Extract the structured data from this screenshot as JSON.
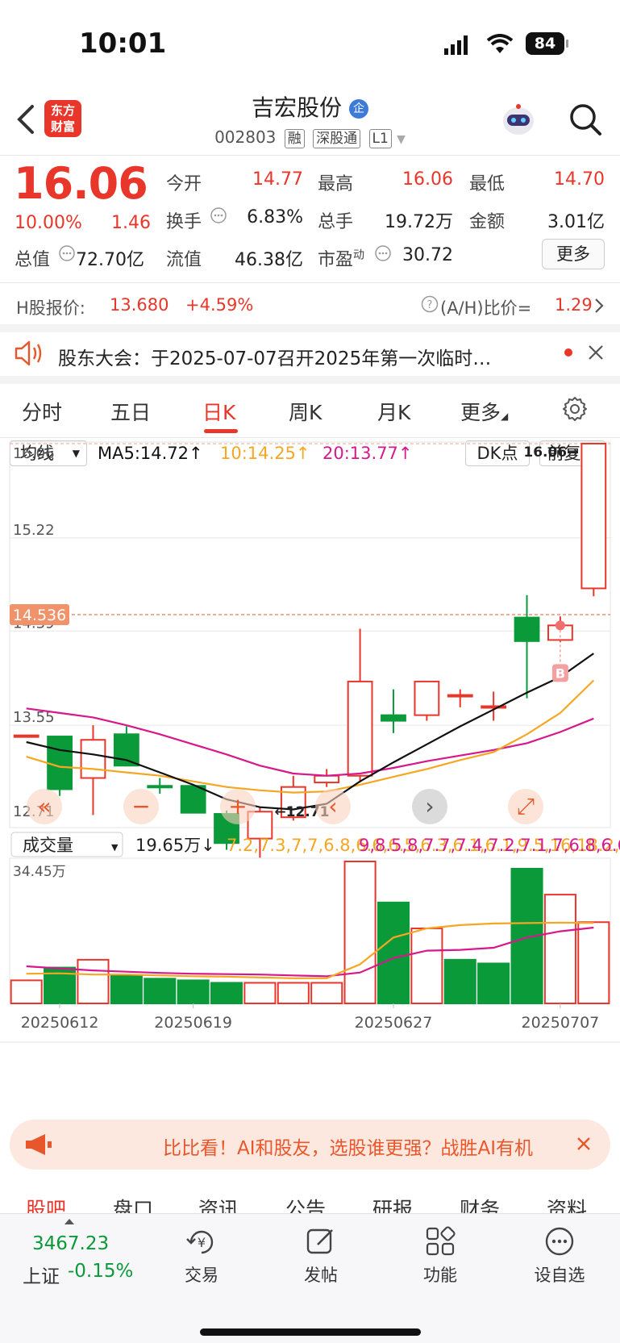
{
  "status_bar": {
    "time": "10:01",
    "battery": "84"
  },
  "header": {
    "logo_text": "东方\n财富",
    "title": "吉宏股份",
    "badge": "企",
    "code": "002803",
    "tags": [
      "融",
      "深股通",
      "L1"
    ]
  },
  "quote": {
    "price": "16.06",
    "change_pct": "10.00%",
    "change_abs": "1.46",
    "rows": [
      [
        {
          "label": "今开",
          "value": "14.77",
          "color": "red"
        },
        {
          "label": "最高",
          "value": "16.06",
          "color": "red"
        },
        {
          "label": "最低",
          "value": "14.70",
          "color": "red"
        }
      ],
      [
        {
          "label": "换手",
          "value": "6.83%",
          "color": "dark"
        },
        {
          "label": "总手",
          "value": "19.72万",
          "color": "dark"
        },
        {
          "label": "金额",
          "value": "3.01亿",
          "color": "dark"
        }
      ]
    ],
    "total_value_label": "总值",
    "total_value": "72.70亿",
    "float_value_label": "流值",
    "float_value": "46.38亿",
    "pe_label": "市盈",
    "pe_sup": "动",
    "pe_value": "30.72",
    "more_label": "更多"
  },
  "h_share": {
    "label": "H股报价:",
    "price": "13.680",
    "change": "+4.59%",
    "ratio_label": "(A/H)比价=",
    "ratio": "1.29"
  },
  "notice": {
    "text": "股东大会：于2025-07-07召开2025年第一次临时…"
  },
  "tabs": [
    {
      "label": "分时",
      "active": false
    },
    {
      "label": "五日",
      "active": false
    },
    {
      "label": "日K",
      "active": true
    },
    {
      "label": "周K",
      "active": false
    },
    {
      "label": "月K",
      "active": false
    },
    {
      "label": "更多",
      "active": false
    }
  ],
  "ma_bar": {
    "selector": "均线",
    "ma5": "MA5:14.72↑",
    "ma10": "10:14.25↑",
    "ma20": "20:13.77↑",
    "dk": "DK点",
    "adjust": "前复权"
  },
  "colors": {
    "up": "#e8362b",
    "down": "#0a9a3a",
    "ma5": "#111111",
    "ma10": "#f5a623",
    "ma20": "#d6188c"
  },
  "chart_data": {
    "type": "candlestick",
    "price_axis_labels": [
      "16.06",
      "15.22",
      "14.39",
      "13.55",
      "12.71"
    ],
    "ylim": [
      12.71,
      16.06
    ],
    "current_price_marker": "14.536",
    "high_annotation": "16.06→",
    "low_annotation": "←12.71",
    "buy_marker": "B",
    "candles": [
      {
        "o": 13.46,
        "h": 13.46,
        "l": 13.46,
        "c": 13.46
      },
      {
        "o": 13.45,
        "h": 13.45,
        "l": 12.92,
        "c": 12.98
      },
      {
        "o": 13.08,
        "h": 13.55,
        "l": 12.75,
        "c": 13.42
      },
      {
        "o": 13.47,
        "h": 13.54,
        "l": 13.19,
        "c": 13.19
      },
      {
        "o": 13.01,
        "h": 13.08,
        "l": 12.94,
        "c": 13.0
      },
      {
        "o": 13.01,
        "h": 13.01,
        "l": 12.77,
        "c": 12.77
      },
      {
        "o": 12.76,
        "h": 12.79,
        "l": 12.44,
        "c": 12.5
      },
      {
        "o": 12.54,
        "h": 12.82,
        "l": 12.37,
        "c": 12.78
      },
      {
        "o": 12.73,
        "h": 13.1,
        "l": 12.7,
        "c": 13.0
      },
      {
        "o": 13.04,
        "h": 13.16,
        "l": 13.0,
        "c": 13.1
      },
      {
        "o": 13.1,
        "h": 14.41,
        "l": 13.04,
        "c": 13.94
      },
      {
        "o": 13.64,
        "h": 13.87,
        "l": 13.48,
        "c": 13.59
      },
      {
        "o": 13.64,
        "h": 13.94,
        "l": 13.59,
        "c": 13.94
      },
      {
        "o": 13.82,
        "h": 13.87,
        "l": 13.71,
        "c": 13.82
      },
      {
        "o": 13.72,
        "h": 13.85,
        "l": 13.59,
        "c": 13.72
      },
      {
        "o": 14.51,
        "h": 14.71,
        "l": 13.79,
        "c": 14.3
      },
      {
        "o": 14.31,
        "h": 14.52,
        "l": 14.29,
        "c": 14.44
      },
      {
        "o": 14.77,
        "h": 16.06,
        "l": 14.7,
        "c": 16.06
      }
    ],
    "ma5": [
      13.4,
      13.33,
      13.29,
      13.24,
      13.13,
      13.02,
      12.89,
      12.82,
      12.8,
      12.85,
      13.05,
      13.22,
      13.38,
      13.54,
      13.69,
      13.84,
      13.98,
      14.19
    ],
    "ma10": [
      13.27,
      13.18,
      13.16,
      13.13,
      13.1,
      13.05,
      13.0,
      12.97,
      12.95,
      12.96,
      13.02,
      13.09,
      13.16,
      13.24,
      13.31,
      13.47,
      13.66,
      13.95
    ],
    "ma20": [
      13.7,
      13.66,
      13.62,
      13.55,
      13.47,
      13.38,
      13.29,
      13.19,
      13.12,
      13.1,
      13.12,
      13.17,
      13.23,
      13.28,
      13.33,
      13.39,
      13.49,
      13.61
    ],
    "volume": {
      "selector": "成交量",
      "current": "19.65万↓",
      "ma1": [
        7.2,
        7.3,
        7.0,
        7.0,
        6.8,
        6.6,
        6.5,
        6.3,
        6.1,
        6.1,
        9.5,
        16.0,
        18.2,
        19.0,
        19.4,
        19.5,
        19.6,
        19.53
      ],
      "ma2": [
        9.0,
        8.5,
        8.0,
        7.7,
        7.4,
        7.2,
        7.1,
        7.0,
        6.8,
        6.6,
        7.5,
        11.0,
        12.8,
        13.0,
        13.5,
        16.0,
        17.5,
        18.4
      ],
      "max_label": "34.45万",
      "ylim": [
        0,
        34.45
      ],
      "values": [
        5.6,
        8.7,
        10.6,
        6.8,
        6.0,
        5.6,
        5.0,
        5.0,
        5.0,
        5.0,
        34.45,
        24.5,
        18.2,
        10.6,
        9.7,
        32.7,
        26.4,
        19.72
      ],
      "up": [
        true,
        false,
        true,
        false,
        false,
        false,
        false,
        true,
        true,
        true,
        true,
        false,
        true,
        false,
        false,
        false,
        true,
        true
      ]
    },
    "date_labels": [
      {
        "index": 1,
        "text": "20250612"
      },
      {
        "index": 5,
        "text": "20250619"
      },
      {
        "index": 11,
        "text": "20250627"
      },
      {
        "index": 16,
        "text": "20250707"
      }
    ]
  },
  "ad": {
    "text": "比比看！AI和股友，选股谁更强？战胜AI有机"
  },
  "lower_tabs": [
    "股吧",
    "盘口",
    "资讯",
    "公告",
    "研报",
    "财务",
    "资料"
  ],
  "bottom_nav": {
    "index_value": "3467.23",
    "index_name": "上证",
    "index_change": "-0.15%",
    "items": [
      "交易",
      "发帖",
      "功能",
      "设自选"
    ]
  }
}
